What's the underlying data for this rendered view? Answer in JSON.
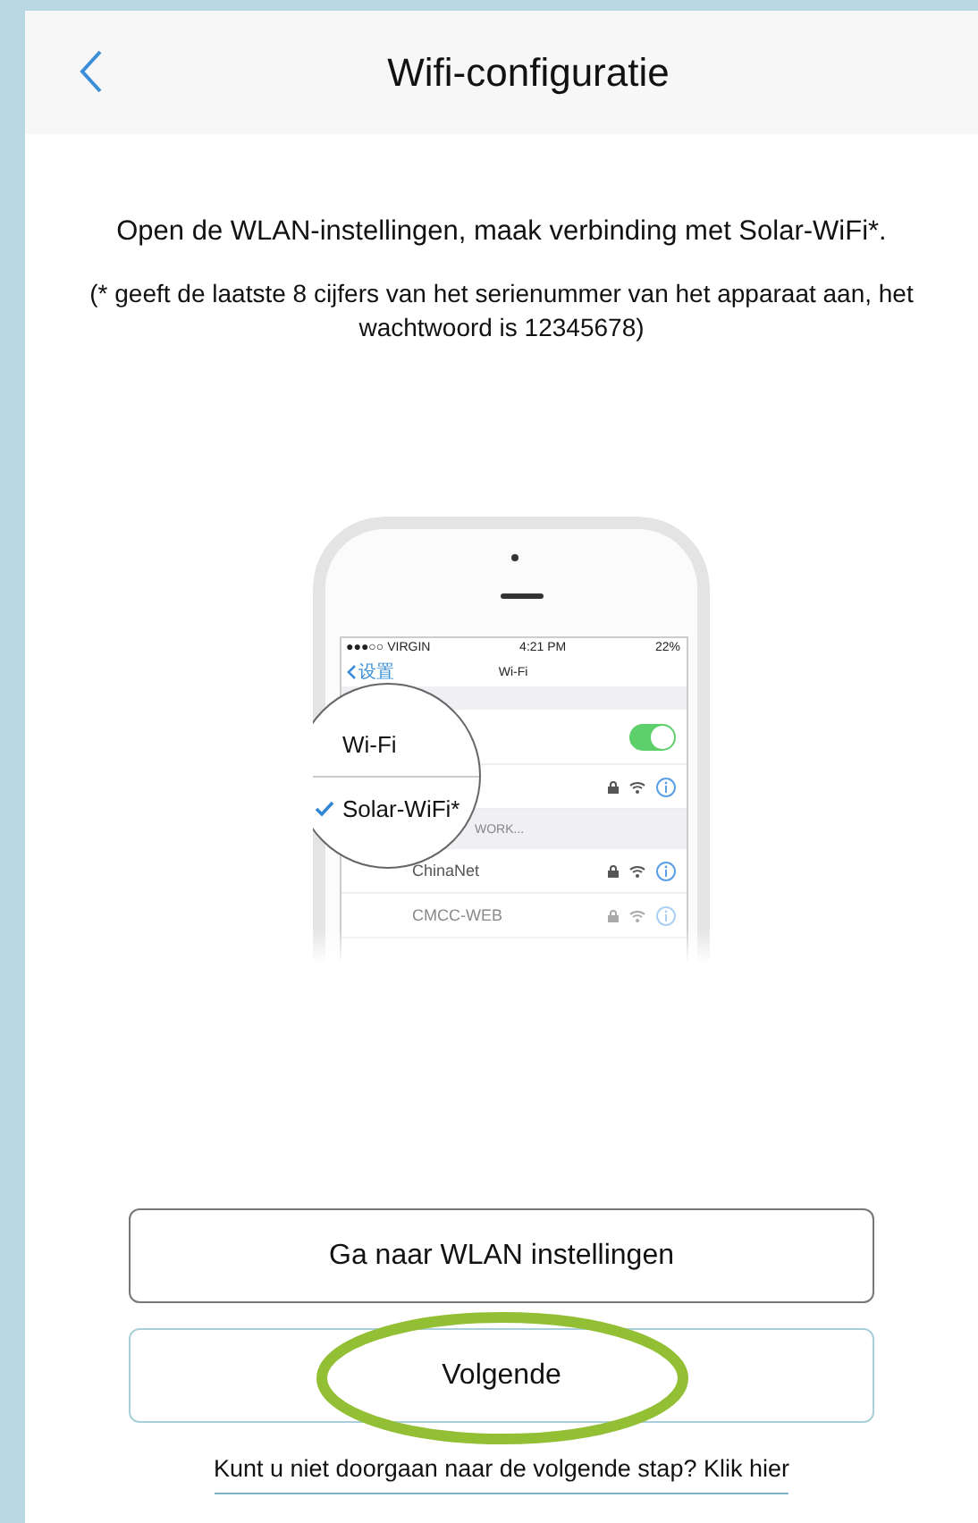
{
  "header": {
    "title": "Wifi-configuratie"
  },
  "instruction": "Open de WLAN-instellingen, maak verbinding met Solar-WiFi*.",
  "note": "(* geeft de laatste 8 cijfers van het serienummer van het apparaat aan, het wachtwoord is 12345678)",
  "phone_screen": {
    "status_bar": {
      "carrier": "●●●○○ VIRGIN",
      "time": "4:21 PM",
      "battery": "22%"
    },
    "nav": {
      "back": "设置",
      "title": "Wi-Fi"
    },
    "wifi_toggle": {
      "label": "Wi-Fi",
      "on": true
    },
    "section_label": "WORK...",
    "networks": [
      {
        "name": "Solar-WiFi*",
        "selected": true
      },
      {
        "name": "ChinaNet",
        "selected": false
      },
      {
        "name": "CMCC-WEB",
        "selected": false
      }
    ]
  },
  "buttons": [
    {
      "label": "Ga naar WLAN instellingen",
      "kind": "outline",
      "highlighted": false
    },
    {
      "label": "Volgende",
      "kind": "primary",
      "highlighted": true
    }
  ],
  "help_link": "Kunt u niet doorgaan naar de volgende stap? Klik hier"
}
